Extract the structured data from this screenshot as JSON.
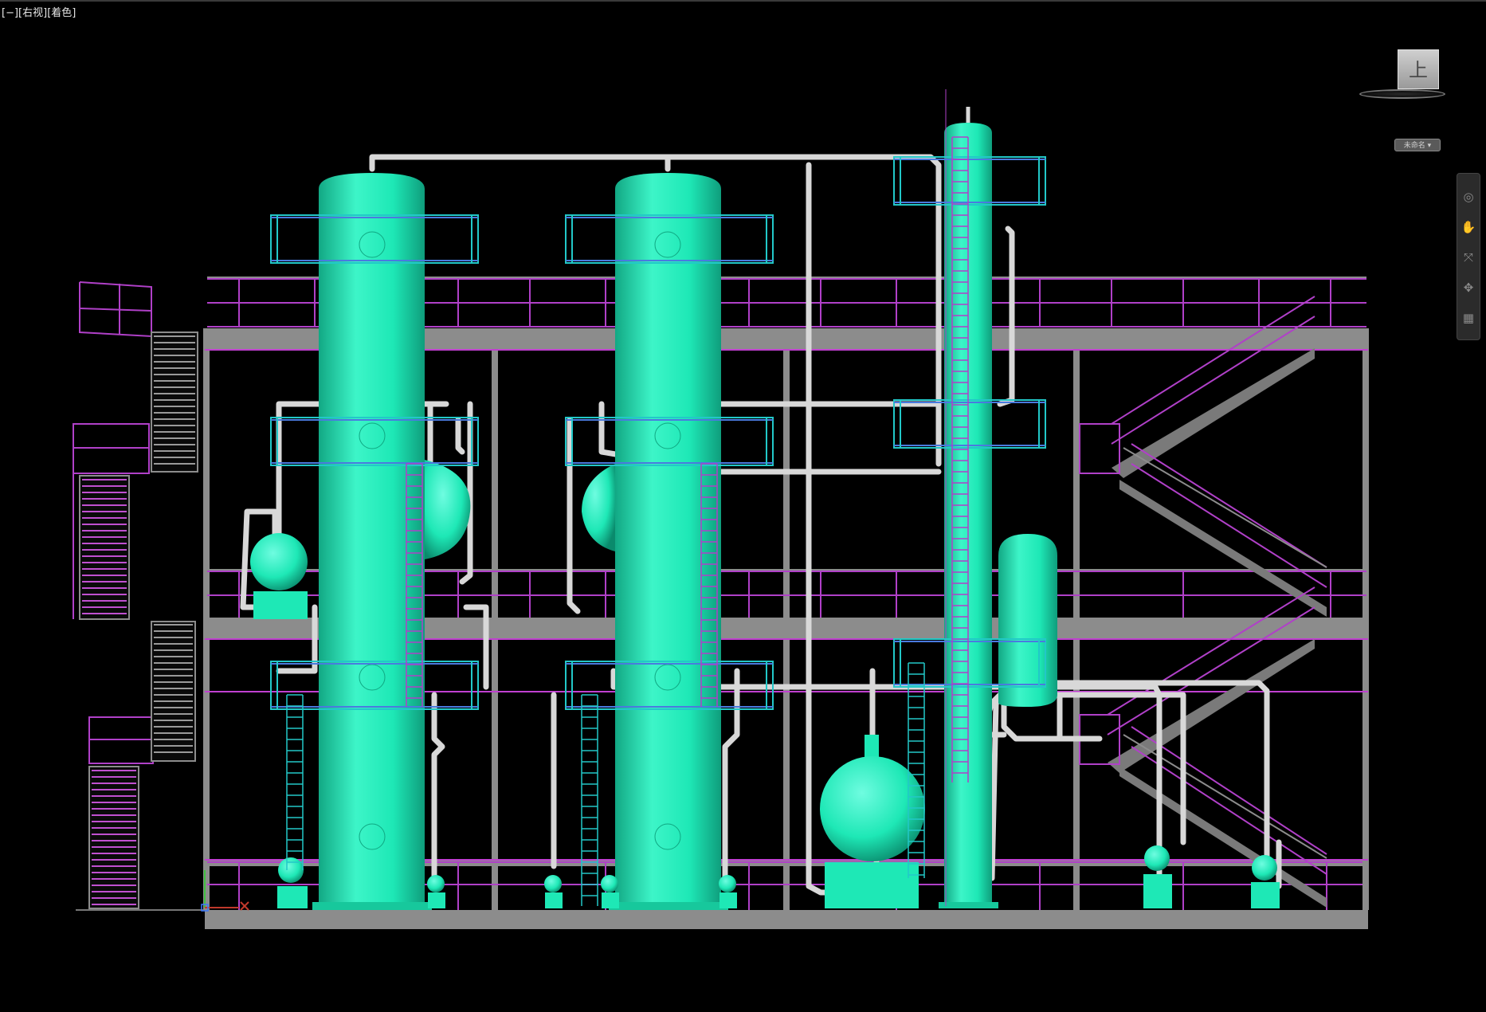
{
  "viewport": {
    "controls_label": "[−]",
    "view_label": "[右视]",
    "style_label": "[着色]"
  },
  "viewcube": {
    "face_label": "上",
    "wcs_label": "未命名 ▾"
  },
  "navbar": {
    "icons": [
      "steering-wheel-icon",
      "pan-hand-icon",
      "zoom-icon",
      "orbit-icon",
      "showmotion-icon"
    ]
  },
  "colors": {
    "vessel": "#1ee8b6",
    "pipe": "#d8d8d8",
    "rail": "#b040c8",
    "platform": "#8a8a8a",
    "steel": "#9a9a9a",
    "ladder_cyan": "#22c8c8"
  }
}
